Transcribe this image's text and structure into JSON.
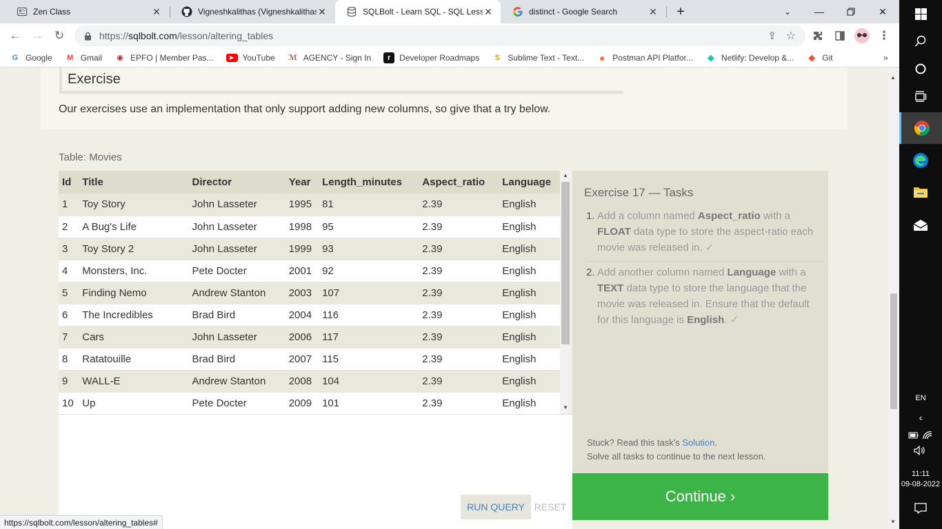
{
  "browser": {
    "tabs": [
      {
        "title": "Zen Class",
        "icon": "zen-class-icon",
        "active": false
      },
      {
        "title": "Vigneshkalithas (Vigneshkalithas)",
        "icon": "github-icon",
        "active": false
      },
      {
        "title": "SQLBolt - Learn SQL - SQL Lesson",
        "icon": "database-icon",
        "active": true
      },
      {
        "title": "distinct - Google Search",
        "icon": "google-icon",
        "active": false
      }
    ],
    "url_host": "sqlbolt.com",
    "url_path": "/lesson/altering_tables",
    "url_prefix": "https://",
    "bookmarks": [
      {
        "label": "Google",
        "icon": "google-icon",
        "color": "#4285f4",
        "glyph": "G"
      },
      {
        "label": "Gmail",
        "icon": "gmail-icon",
        "color": "#ea4335",
        "glyph": "M"
      },
      {
        "label": "EPFO | Member Pas...",
        "icon": "epfo-icon",
        "color": "#b22222",
        "glyph": "◉"
      },
      {
        "label": "YouTube",
        "icon": "youtube-icon",
        "color": "#ff0000",
        "glyph": "▶"
      },
      {
        "label": "AGENCY - Sign In",
        "icon": "agency-icon",
        "color": "#c0392b",
        "glyph": "ℳ"
      },
      {
        "label": "Developer Roadmaps",
        "icon": "roadmaps-icon",
        "color": "#111111",
        "glyph": "r"
      },
      {
        "label": "Sublime Text - Text...",
        "icon": "sublime-icon",
        "color": "#ff9800",
        "glyph": "S"
      },
      {
        "label": "Postman API Platfor...",
        "icon": "postman-icon",
        "color": "#ff6c37",
        "glyph": "●"
      },
      {
        "label": "Netlify: Develop &...",
        "icon": "netlify-icon",
        "color": "#20c6b7",
        "glyph": "◆"
      },
      {
        "label": "Git",
        "icon": "git-icon",
        "color": "#f05032",
        "glyph": "◆"
      }
    ],
    "status_url": "https://sqlbolt.com/lesson/altering_tables#"
  },
  "lesson": {
    "exercise_heading": "Exercise",
    "exercise_intro": "Our exercises use an implementation that only support adding new columns, so give that a try below."
  },
  "table": {
    "caption": "Table: Movies",
    "columns": [
      "Id",
      "Title",
      "Director",
      "Year",
      "Length_minutes",
      "Aspect_ratio",
      "Language"
    ],
    "rows": [
      [
        "1",
        "Toy Story",
        "John Lasseter",
        "1995",
        "81",
        "2.39",
        "English"
      ],
      [
        "2",
        "A Bug's Life",
        "John Lasseter",
        "1998",
        "95",
        "2.39",
        "English"
      ],
      [
        "3",
        "Toy Story 2",
        "John Lasseter",
        "1999",
        "93",
        "2.39",
        "English"
      ],
      [
        "4",
        "Monsters, Inc.",
        "Pete Docter",
        "2001",
        "92",
        "2.39",
        "English"
      ],
      [
        "5",
        "Finding Nemo",
        "Andrew Stanton",
        "2003",
        "107",
        "2.39",
        "English"
      ],
      [
        "6",
        "The Incredibles",
        "Brad Bird",
        "2004",
        "116",
        "2.39",
        "English"
      ],
      [
        "7",
        "Cars",
        "John Lasseter",
        "2006",
        "117",
        "2.39",
        "English"
      ],
      [
        "8",
        "Ratatouille",
        "Brad Bird",
        "2007",
        "115",
        "2.39",
        "English"
      ],
      [
        "9",
        "WALL-E",
        "Andrew Stanton",
        "2008",
        "104",
        "2.39",
        "English"
      ],
      [
        "10",
        "Up",
        "Pete Docter",
        "2009",
        "101",
        "2.39",
        "English"
      ]
    ]
  },
  "tasks": {
    "title": "Exercise 17 — Tasks",
    "task1": {
      "num": "1.",
      "pre": "Add a column named ",
      "b1": "Aspect_ratio",
      "mid": " with a ",
      "b2": "FLOAT",
      "post": " data type to store the aspect-ratio each movie was released in.",
      "check": "✓"
    },
    "task2": {
      "num": "2.",
      "pre": "Add another column named ",
      "b1": "Language",
      "mid": " with a ",
      "b2": "TEXT",
      "post": " data type to store the language that the movie was released in. Ensure that the default for this language is ",
      "b3": "English",
      "end": ".",
      "check": "✓"
    },
    "stuck_pre": "Stuck? Read this task's ",
    "solution_link": "Solution",
    "stuck_post": ".",
    "solve_all": "Solve all tasks to continue to the next lesson.",
    "continue_label": "Continue ›"
  },
  "editor": {
    "run_label": "RUN QUERY",
    "reset_label": "RESET"
  },
  "taskbar": {
    "language": "EN",
    "time": "11:11",
    "date": "09-08-2022"
  }
}
